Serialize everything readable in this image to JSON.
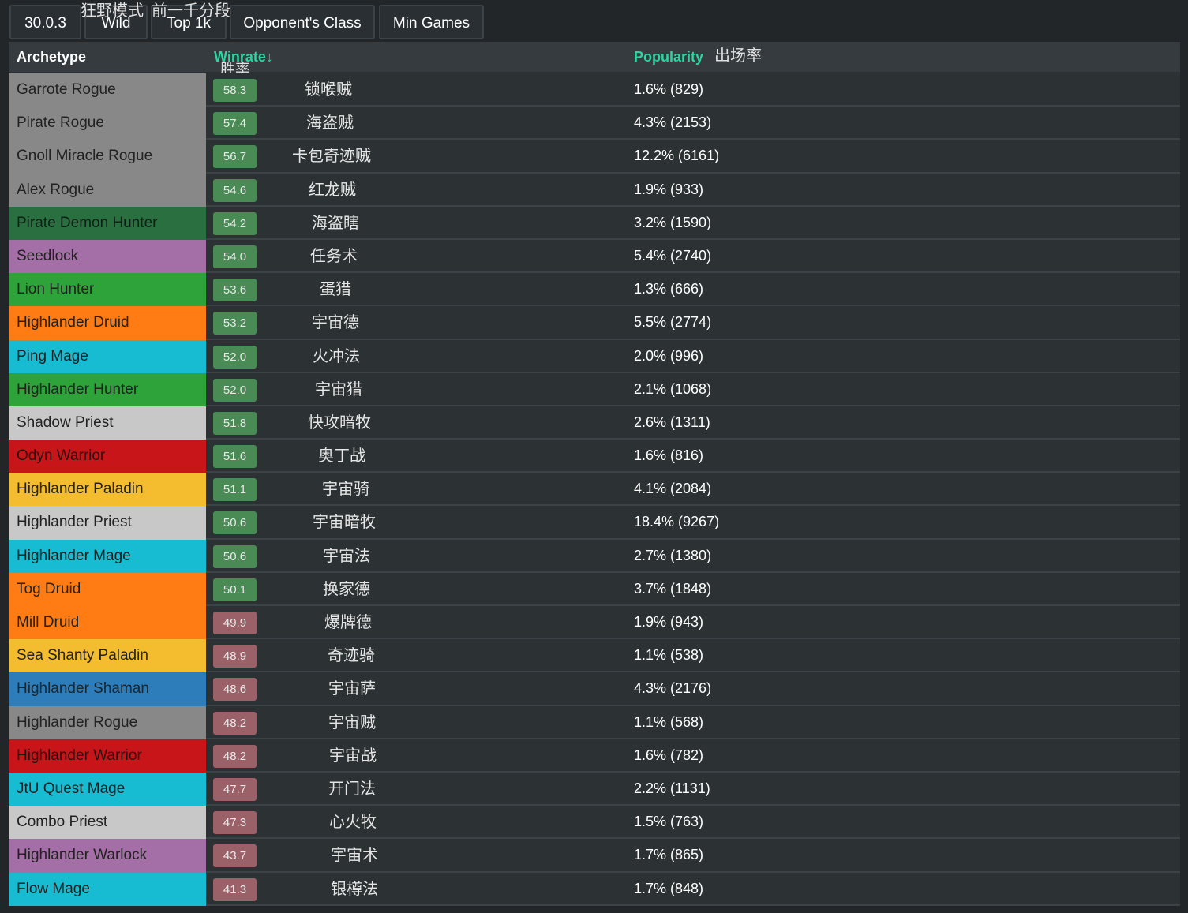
{
  "toolbar": {
    "patch": "30.0.3",
    "mode": "Wild",
    "rank": "Top 1k",
    "opponent": "Opponent's Class",
    "min_games": "Min Games",
    "mode_cn": "狂野模式",
    "rank_cn": "前一千分段"
  },
  "header": {
    "archetype": "Archetype",
    "winrate": "Winrate↓",
    "winrate_cn": "胜率",
    "popularity": "Popularity",
    "popularity_cn": "出场率"
  },
  "colors": {
    "rogue": "#888888",
    "demon_hunter": "#2a6f3f",
    "warlock": "#a46fa6",
    "hunter": "#2ea33a",
    "druid": "#ff7c14",
    "mage": "#17bcd3",
    "priest": "#c8c8c8",
    "warrior": "#c8151a",
    "paladin": "#f3bd2f",
    "shaman": "#2c7db9",
    "winrate_green": "#4a8a55",
    "winrate_red": "#9b6168"
  },
  "rows": [
    {
      "name": "Garrote Rogue",
      "cls": "rogue",
      "winrate": "58.3",
      "cn": "锁喉贼",
      "popularity": "1.6% (829)"
    },
    {
      "name": "Pirate Rogue",
      "cls": "rogue",
      "winrate": "57.4",
      "cn": "海盗贼",
      "popularity": "4.3% (2153)"
    },
    {
      "name": "Gnoll Miracle Rogue",
      "cls": "rogue",
      "winrate": "56.7",
      "cn": "卡包奇迹贼",
      "popularity": "12.2% (6161)"
    },
    {
      "name": "Alex Rogue",
      "cls": "rogue",
      "winrate": "54.6",
      "cn": "红龙贼",
      "popularity": "1.9% (933)"
    },
    {
      "name": "Pirate Demon Hunter",
      "cls": "demon_hunter",
      "winrate": "54.2",
      "cn": "海盗瞎",
      "popularity": "3.2% (1590)"
    },
    {
      "name": "Seedlock",
      "cls": "warlock",
      "winrate": "54.0",
      "cn": "任务术",
      "popularity": "5.4% (2740)"
    },
    {
      "name": "Lion Hunter",
      "cls": "hunter",
      "winrate": "53.6",
      "cn": "蛋猎",
      "popularity": "1.3% (666)"
    },
    {
      "name": "Highlander Druid",
      "cls": "druid",
      "winrate": "53.2",
      "cn": "宇宙德",
      "popularity": "5.5% (2774)"
    },
    {
      "name": "Ping Mage",
      "cls": "mage",
      "winrate": "52.0",
      "cn": "火冲法",
      "popularity": "2.0% (996)"
    },
    {
      "name": "Highlander Hunter",
      "cls": "hunter",
      "winrate": "52.0",
      "cn": "宇宙猎",
      "popularity": "2.1% (1068)"
    },
    {
      "name": "Shadow Priest",
      "cls": "priest",
      "winrate": "51.8",
      "cn": "快攻暗牧",
      "popularity": "2.6% (1311)"
    },
    {
      "name": "Odyn Warrior",
      "cls": "warrior",
      "winrate": "51.6",
      "cn": "奥丁战",
      "popularity": "1.6% (816)"
    },
    {
      "name": "Highlander Paladin",
      "cls": "paladin",
      "winrate": "51.1",
      "cn": "宇宙骑",
      "popularity": "4.1% (2084)"
    },
    {
      "name": "Highlander Priest",
      "cls": "priest",
      "winrate": "50.6",
      "cn": "宇宙暗牧",
      "popularity": "18.4% (9267)"
    },
    {
      "name": "Highlander Mage",
      "cls": "mage",
      "winrate": "50.6",
      "cn": "宇宙法",
      "popularity": "2.7% (1380)"
    },
    {
      "name": "Tog Druid",
      "cls": "druid",
      "winrate": "50.1",
      "cn": "换家德",
      "popularity": "3.7% (1848)"
    },
    {
      "name": "Mill Druid",
      "cls": "druid",
      "winrate": "49.9",
      "cn": "爆牌德",
      "popularity": "1.9% (943)"
    },
    {
      "name": "Sea Shanty Paladin",
      "cls": "paladin",
      "winrate": "48.9",
      "cn": "奇迹骑",
      "popularity": "1.1% (538)"
    },
    {
      "name": "Highlander Shaman",
      "cls": "shaman",
      "winrate": "48.6",
      "cn": "宇宙萨",
      "popularity": "4.3% (2176)"
    },
    {
      "name": "Highlander Rogue",
      "cls": "rogue",
      "winrate": "48.2",
      "cn": "宇宙贼",
      "popularity": "1.1% (568)"
    },
    {
      "name": "Highlander Warrior",
      "cls": "warrior",
      "winrate": "48.2",
      "cn": "宇宙战",
      "popularity": "1.6% (782)"
    },
    {
      "name": "JtU Quest Mage",
      "cls": "mage",
      "winrate": "47.7",
      "cn": "开门法",
      "popularity": "2.2% (1131)"
    },
    {
      "name": "Combo Priest",
      "cls": "priest",
      "winrate": "47.3",
      "cn": "心火牧",
      "popularity": "1.5% (763)"
    },
    {
      "name": "Highlander Warlock",
      "cls": "warlock",
      "winrate": "43.7",
      "cn": "宇宙术",
      "popularity": "1.7% (865)"
    },
    {
      "name": "Flow Mage",
      "cls": "mage",
      "winrate": "41.3",
      "cn": "银樽法",
      "popularity": "1.7% (848)"
    }
  ]
}
